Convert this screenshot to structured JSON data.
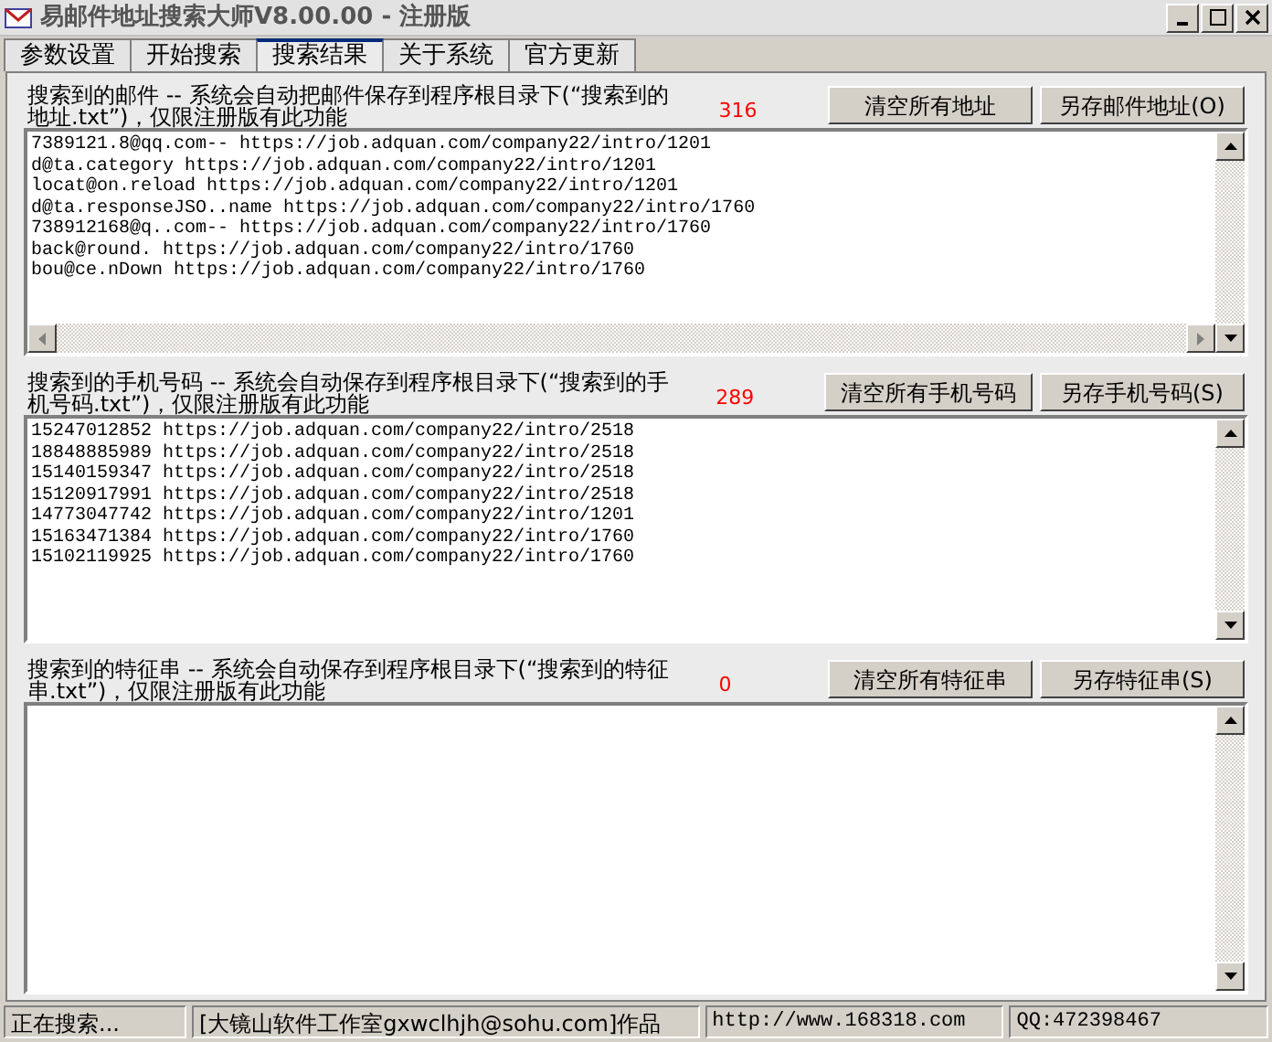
{
  "window": {
    "title": "易邮件地址搜索大师V8.00.00 - 注册版"
  },
  "tabs": [
    {
      "label": "参数设置",
      "selected": false
    },
    {
      "label": "开始搜索",
      "selected": false
    },
    {
      "label": "搜索结果",
      "selected": true
    },
    {
      "label": "关于系统",
      "selected": false
    },
    {
      "label": "官方更新",
      "selected": false
    }
  ],
  "sections": [
    {
      "heading": "搜索到的邮件 -- 系统会自动把邮件保存到程序根目录下(“搜索到的地址.txt”)，仅限注册版有此功能",
      "count": "316",
      "buttons": [
        "清空所有地址",
        "另存邮件地址(O)"
      ],
      "horizontal_scrollbar": true,
      "lines": [
        "7389121.8@qq.com-- https://job.adquan.com/company22/intro/1201",
        "d@ta.category https://job.adquan.com/company22/intro/1201",
        "locat@on.reload https://job.adquan.com/company22/intro/1201",
        "d@ta.responseJSO..name https://job.adquan.com/company22/intro/1760",
        "738912168@q..com-- https://job.adquan.com/company22/intro/1760",
        "back@round. https://job.adquan.com/company22/intro/1760",
        "bou@ce.nDown https://job.adquan.com/company22/intro/1760"
      ]
    },
    {
      "heading": "搜索到的手机号码 -- 系统会自动保存到程序根目录下(“搜索到的手机号码.txt”)，仅限注册版有此功能",
      "count": "289",
      "buttons": [
        "清空所有手机号码",
        "另存手机号码(S)"
      ],
      "horizontal_scrollbar": false,
      "lines": [
        "15247012852 https://job.adquan.com/company22/intro/2518",
        "18848885989 https://job.adquan.com/company22/intro/2518",
        "15140159347 https://job.adquan.com/company22/intro/2518",
        "15120917991 https://job.adquan.com/company22/intro/2518",
        "14773047742 https://job.adquan.com/company22/intro/1201",
        "15163471384 https://job.adquan.com/company22/intro/1760",
        "15102119925 https://job.adquan.com/company22/intro/1760"
      ]
    },
    {
      "heading": "搜索到的特征串 -- 系统会自动保存到程序根目录下(“搜索到的特征串.txt”)，仅限注册版有此功能",
      "count": "0",
      "buttons": [
        "清空所有特征串",
        "另存特征串(S)"
      ],
      "horizontal_scrollbar": false
    }
  ],
  "status_bar": [
    "正在搜索...",
    "[大镜山软件工作室gxwclhjh@sohu.com]作品",
    "http://www.168318.com",
    "QQ:472398467"
  ]
}
